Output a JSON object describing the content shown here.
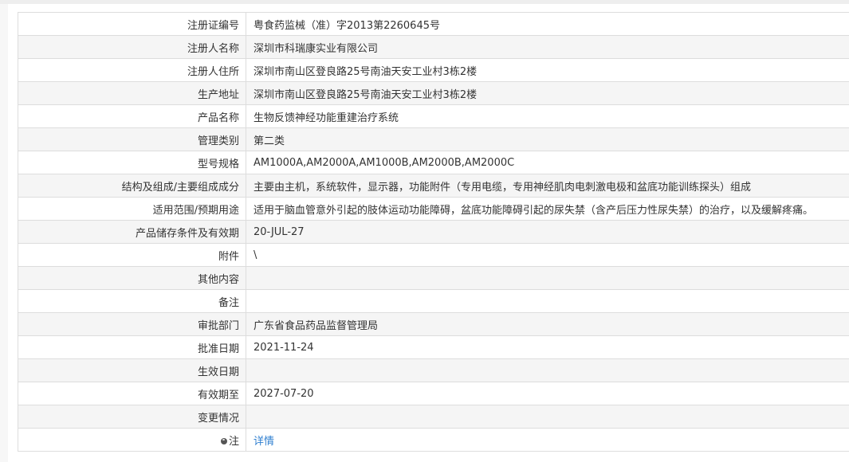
{
  "rows": [
    {
      "label": "注册证编号",
      "value": "粤食药监械（准）字2013第2260645号"
    },
    {
      "label": "注册人名称",
      "value": "深圳市科瑞康实业有限公司"
    },
    {
      "label": "注册人住所",
      "value": "深圳市南山区登良路25号南油天安工业村3栋2楼"
    },
    {
      "label": "生产地址",
      "value": "深圳市南山区登良路25号南油天安工业村3栋2楼"
    },
    {
      "label": "产品名称",
      "value": "生物反馈神经功能重建治疗系统"
    },
    {
      "label": "管理类别",
      "value": "第二类"
    },
    {
      "label": "型号规格",
      "value": "AM1000A,AM2000A,AM1000B,AM2000B,AM2000C"
    },
    {
      "label": "结构及组成/主要组成成分",
      "value": "主要由主机，系统软件，显示器，功能附件（专用电缆，专用神经肌肉电刺激电极和盆底功能训练探头）组成"
    },
    {
      "label": "适用范围/预期用途",
      "value": "适用于脑血管意外引起的肢体运动功能障碍，盆底功能障碍引起的尿失禁（含产后压力性尿失禁）的治疗，以及缓解疼痛。"
    },
    {
      "label": "产品储存条件及有效期",
      "value": "20-JUL-27"
    },
    {
      "label": "附件",
      "value": "\\"
    },
    {
      "label": "其他内容",
      "value": ""
    },
    {
      "label": "备注",
      "value": ""
    },
    {
      "label": "审批部门",
      "value": "广东省食品药品监督管理局"
    },
    {
      "label": "批准日期",
      "value": "2021-11-24"
    },
    {
      "label": "生效日期",
      "value": ""
    },
    {
      "label": "有效期至",
      "value": "2027-07-20"
    },
    {
      "label": "变更情况",
      "value": ""
    }
  ],
  "note": {
    "label": "注",
    "icon": "pin-icon",
    "link_text": "详情",
    "link_color": "#2f7fd0"
  }
}
